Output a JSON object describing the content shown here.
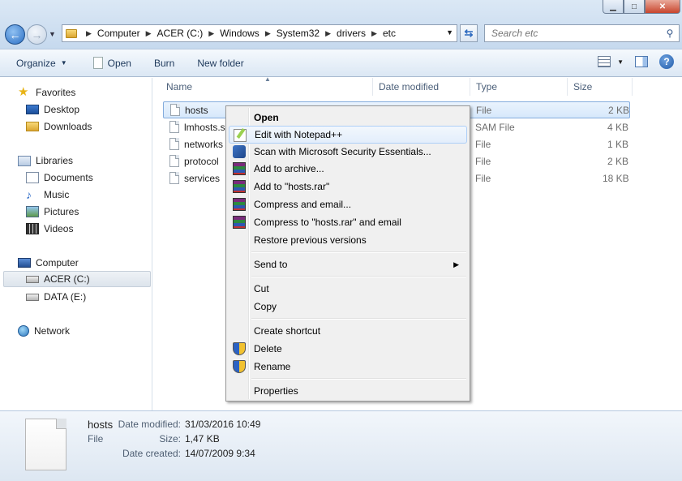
{
  "window": {
    "buttons": [
      "minimize",
      "maximize",
      "close"
    ]
  },
  "address": {
    "crumbs": [
      "Computer",
      "ACER (C:)",
      "Windows",
      "System32",
      "drivers",
      "etc"
    ],
    "search_placeholder": "Search etc"
  },
  "toolbar": {
    "organize": "Organize",
    "open": "Open",
    "burn": "Burn",
    "new_folder": "New folder"
  },
  "nav": {
    "favorites": "Favorites",
    "desktop": "Desktop",
    "downloads": "Downloads",
    "libraries": "Libraries",
    "documents": "Documents",
    "music": "Music",
    "pictures": "Pictures",
    "videos": "Videos",
    "computer": "Computer",
    "acer": "ACER (C:)",
    "data": "DATA (E:)",
    "network": "Network"
  },
  "columns": {
    "name": "Name",
    "date_modified": "Date modified",
    "type": "Type",
    "size": "Size"
  },
  "files": [
    {
      "name": "hosts",
      "type": "File",
      "size": "2 KB"
    },
    {
      "name": "lmhosts.sam",
      "type": "SAM File",
      "size": "4 KB"
    },
    {
      "name": "networks",
      "type": "File",
      "size": "1 KB"
    },
    {
      "name": "protocol",
      "type": "File",
      "size": "2 KB"
    },
    {
      "name": "services",
      "type": "File",
      "size": "18 KB"
    }
  ],
  "context_menu": {
    "open": "Open",
    "edit_notepad": "Edit with Notepad++",
    "scan_mse": "Scan with Microsoft Security Essentials...",
    "add_archive": "Add to archive...",
    "add_rar": "Add to \"hosts.rar\"",
    "compress_email": "Compress and email...",
    "compress_rar_email": "Compress to \"hosts.rar\" and email",
    "restore": "Restore previous versions",
    "send_to": "Send to",
    "cut": "Cut",
    "copy": "Copy",
    "create_shortcut": "Create shortcut",
    "delete": "Delete",
    "rename": "Rename",
    "properties": "Properties"
  },
  "details": {
    "name": "hosts",
    "type": "File",
    "date_modified_label": "Date modified:",
    "date_modified": "31/03/2016 10:49",
    "size_label": "Size:",
    "size": "1,47 KB",
    "date_created_label": "Date created:",
    "date_created": "14/07/2009 9:34"
  }
}
